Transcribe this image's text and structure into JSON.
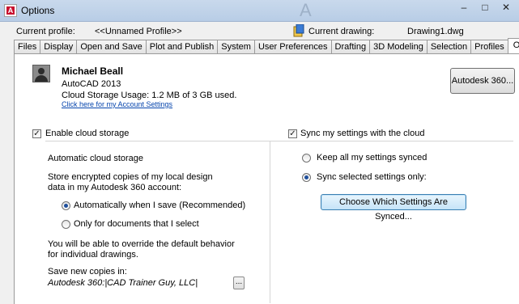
{
  "window": {
    "title": "Options",
    "ghost_text": "A",
    "buttons": {
      "minimize": "–",
      "maximize": "□",
      "close": "✕"
    }
  },
  "profile": {
    "label": "Current profile:",
    "value": "<<Unnamed Profile>>",
    "drawing_label": "Current drawing:",
    "drawing_value": "Drawing1.dwg"
  },
  "tabs": [
    {
      "label": "Files",
      "active": false
    },
    {
      "label": "Display",
      "active": false
    },
    {
      "label": "Open and Save",
      "active": false
    },
    {
      "label": "Plot and Publish",
      "active": false
    },
    {
      "label": "System",
      "active": false
    },
    {
      "label": "User Preferences",
      "active": false
    },
    {
      "label": "Drafting",
      "active": false
    },
    {
      "label": "3D Modeling",
      "active": false
    },
    {
      "label": "Selection",
      "active": false
    },
    {
      "label": "Profiles",
      "active": false
    },
    {
      "label": "Online",
      "active": true
    }
  ],
  "user": {
    "name": "Michael Beall",
    "product": "AutoCAD 2013",
    "storage": "Cloud Storage Usage: 1.2 MB of 3 GB used.",
    "account_link": "Click here for my Account Settings",
    "a360_button": "Autodesk 360..."
  },
  "left": {
    "enable_label": "Enable cloud storage",
    "enable_checked": true,
    "section_heading": "Automatic cloud storage",
    "store_text": "Store encrypted copies of my local design data in my Autodesk 360 account:",
    "radio_auto": "Automatically when I save (Recommended)",
    "radio_auto_selected": true,
    "radio_only": "Only for documents that I select",
    "radio_only_selected": false,
    "override_text": "You will be able to override the default behavior for individual drawings.",
    "save_new_label": "Save new copies in:",
    "save_path": "Autodesk 360:|CAD Trainer Guy, LLC|",
    "browse_label": "..."
  },
  "right": {
    "sync_label": "Sync my settings with the cloud",
    "sync_checked": true,
    "radio_keep": "Keep all my settings synced",
    "radio_keep_selected": false,
    "radio_selected": "Sync selected settings only:",
    "radio_selected_selected": true,
    "choose_button": "Choose Which Settings Are Synced..."
  }
}
